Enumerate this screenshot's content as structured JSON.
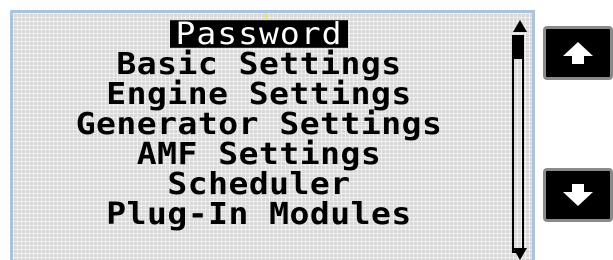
{
  "menu": {
    "items": [
      {
        "label": "Password",
        "selected": true
      },
      {
        "label": "Basic Settings",
        "selected": false
      },
      {
        "label": "Engine Settings",
        "selected": false
      },
      {
        "label": "Generator Settings",
        "selected": false
      },
      {
        "label": "AMF Settings",
        "selected": false
      },
      {
        "label": "Scheduler",
        "selected": false
      },
      {
        "label": "Plug-In Modules",
        "selected": false
      }
    ]
  },
  "scrollbar": {
    "position": 0.0,
    "up_icon": "triangle-up-icon",
    "down_icon": "triangle-down-icon"
  },
  "buttons": {
    "up_icon": "arrow-up-icon",
    "down_icon": "arrow-down-icon"
  },
  "colors": {
    "lcd_background": "#d8d8d8",
    "lcd_border": "#a9c4dc",
    "text": "#000000",
    "selected_bg": "#000000",
    "selected_text": "#ffffff",
    "button_bg": "#000000",
    "button_border": "#8a8a8a",
    "button_icon": "#ffffff"
  }
}
